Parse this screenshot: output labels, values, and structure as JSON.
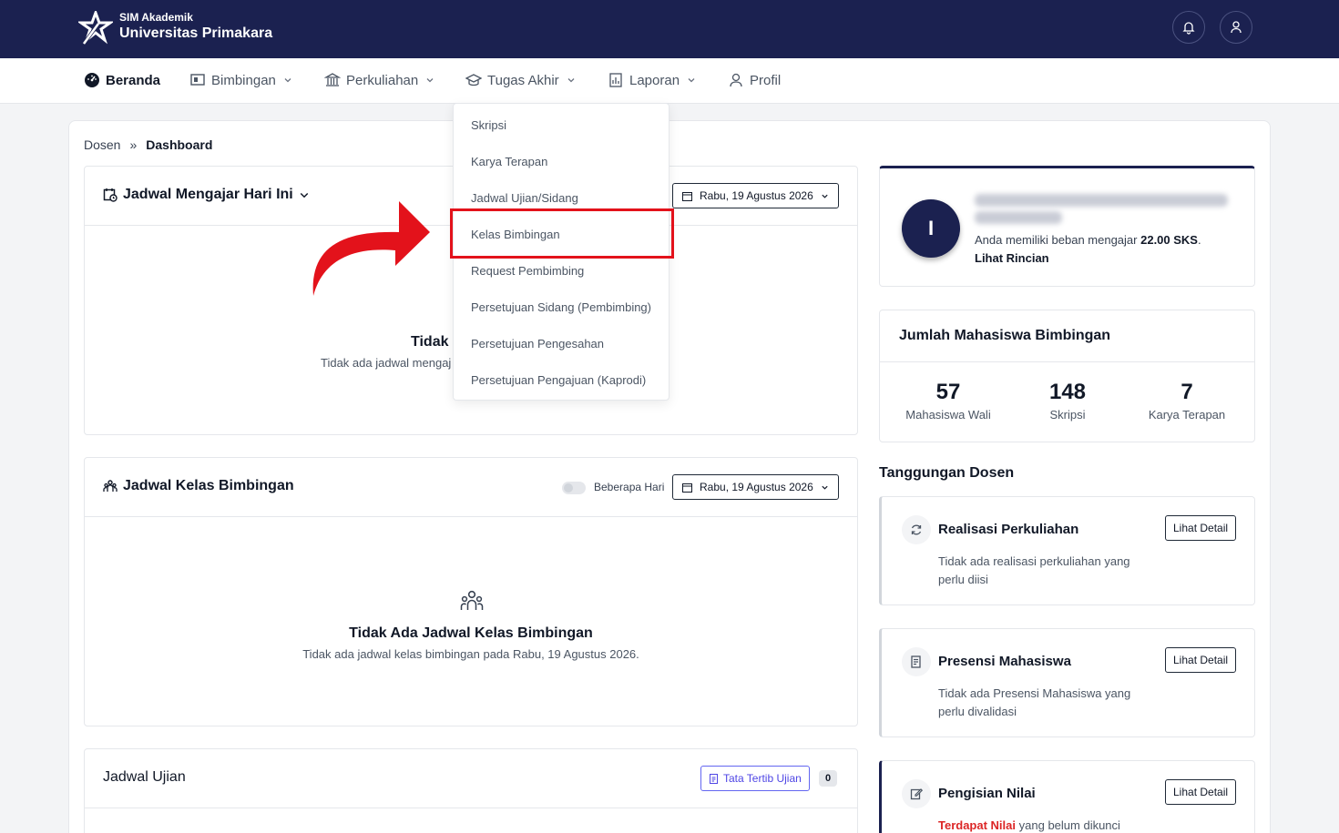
{
  "brand": {
    "small": "SIM Akademik",
    "big": "Universitas Primakara"
  },
  "nav": {
    "items": [
      {
        "label": "Beranda",
        "icon": "dashboard-icon"
      },
      {
        "label": "Bimbingan",
        "icon": "board-icon"
      },
      {
        "label": "Perkuliahan",
        "icon": "institution-icon"
      },
      {
        "label": "Tugas Akhir",
        "icon": "graduation-cap-icon"
      },
      {
        "label": "Laporan",
        "icon": "report-icon"
      },
      {
        "label": "Profil",
        "icon": "user-icon"
      }
    ]
  },
  "breadcrumb": {
    "parent": "Dosen",
    "separator": "»",
    "current": "Dashboard"
  },
  "dropdown": {
    "items": [
      "Skripsi",
      "Karya Terapan",
      "Jadwal Ujian/Sidang",
      "Kelas Bimbingan",
      "Request Pembimbing",
      "Persetujuan Sidang (Pembimbing)",
      "Persetujuan Pengesahan",
      "Persetujuan Pengajuan (Kaprodi)"
    ],
    "highlighted": "Kelas Bimbingan"
  },
  "jadwal_mengajar": {
    "title": "Jadwal Mengajar Hari Ini",
    "date": "Rabu, 19 Agustus 2026",
    "empty_title": "Tidak",
    "empty_sub": "Tidak ada jadwal mengaj"
  },
  "jadwal_kelas": {
    "title": "Jadwal Kelas Bimbingan",
    "toggle_label": "Beberapa Hari",
    "date": "Rabu, 19 Agustus 2026",
    "empty_title": "Tidak Ada Jadwal Kelas Bimbingan",
    "empty_sub": "Tidak ada jadwal kelas bimbingan pada Rabu, 19 Agustus 2026."
  },
  "jadwal_ujian": {
    "title": "Jadwal Ujian",
    "button": "Tata Tertib Ujian",
    "count": "0"
  },
  "profile": {
    "initial": "I",
    "sks_prefix": "Anda memiliki beban mengajar",
    "sks_value": "22.00 SKS",
    "sks_suffix": ".",
    "link": "Lihat Rincian"
  },
  "mahasiswa": {
    "title": "Jumlah Mahasiswa Bimbingan",
    "stats": [
      {
        "value": "57",
        "label": "Mahasiswa Wali"
      },
      {
        "value": "148",
        "label": "Skripsi"
      },
      {
        "value": "7",
        "label": "Karya Terapan"
      }
    ]
  },
  "tanggungan": {
    "title": "Tanggungan Dosen",
    "cards": [
      {
        "title": "Realisasi Perkuliahan",
        "desc": "Tidak ada realisasi perkuliahan yang perlu diisi",
        "button": "Lihat Detail",
        "icon": "refresh-icon"
      },
      {
        "title": "Presensi Mahasiswa",
        "desc": "Tidak ada Presensi Mahasiswa yang perlu divalidasi",
        "button": "Lihat Detail",
        "icon": "document-icon"
      },
      {
        "title": "Pengisian Nilai",
        "desc_red": "Terdapat Nilai",
        "desc": "yang belum dikunci",
        "button": "Lihat Detail",
        "icon": "edit-icon"
      }
    ]
  },
  "colors": {
    "navy": "#1b2150",
    "highlight": "#e3121b",
    "accent": "#4f46e5"
  }
}
